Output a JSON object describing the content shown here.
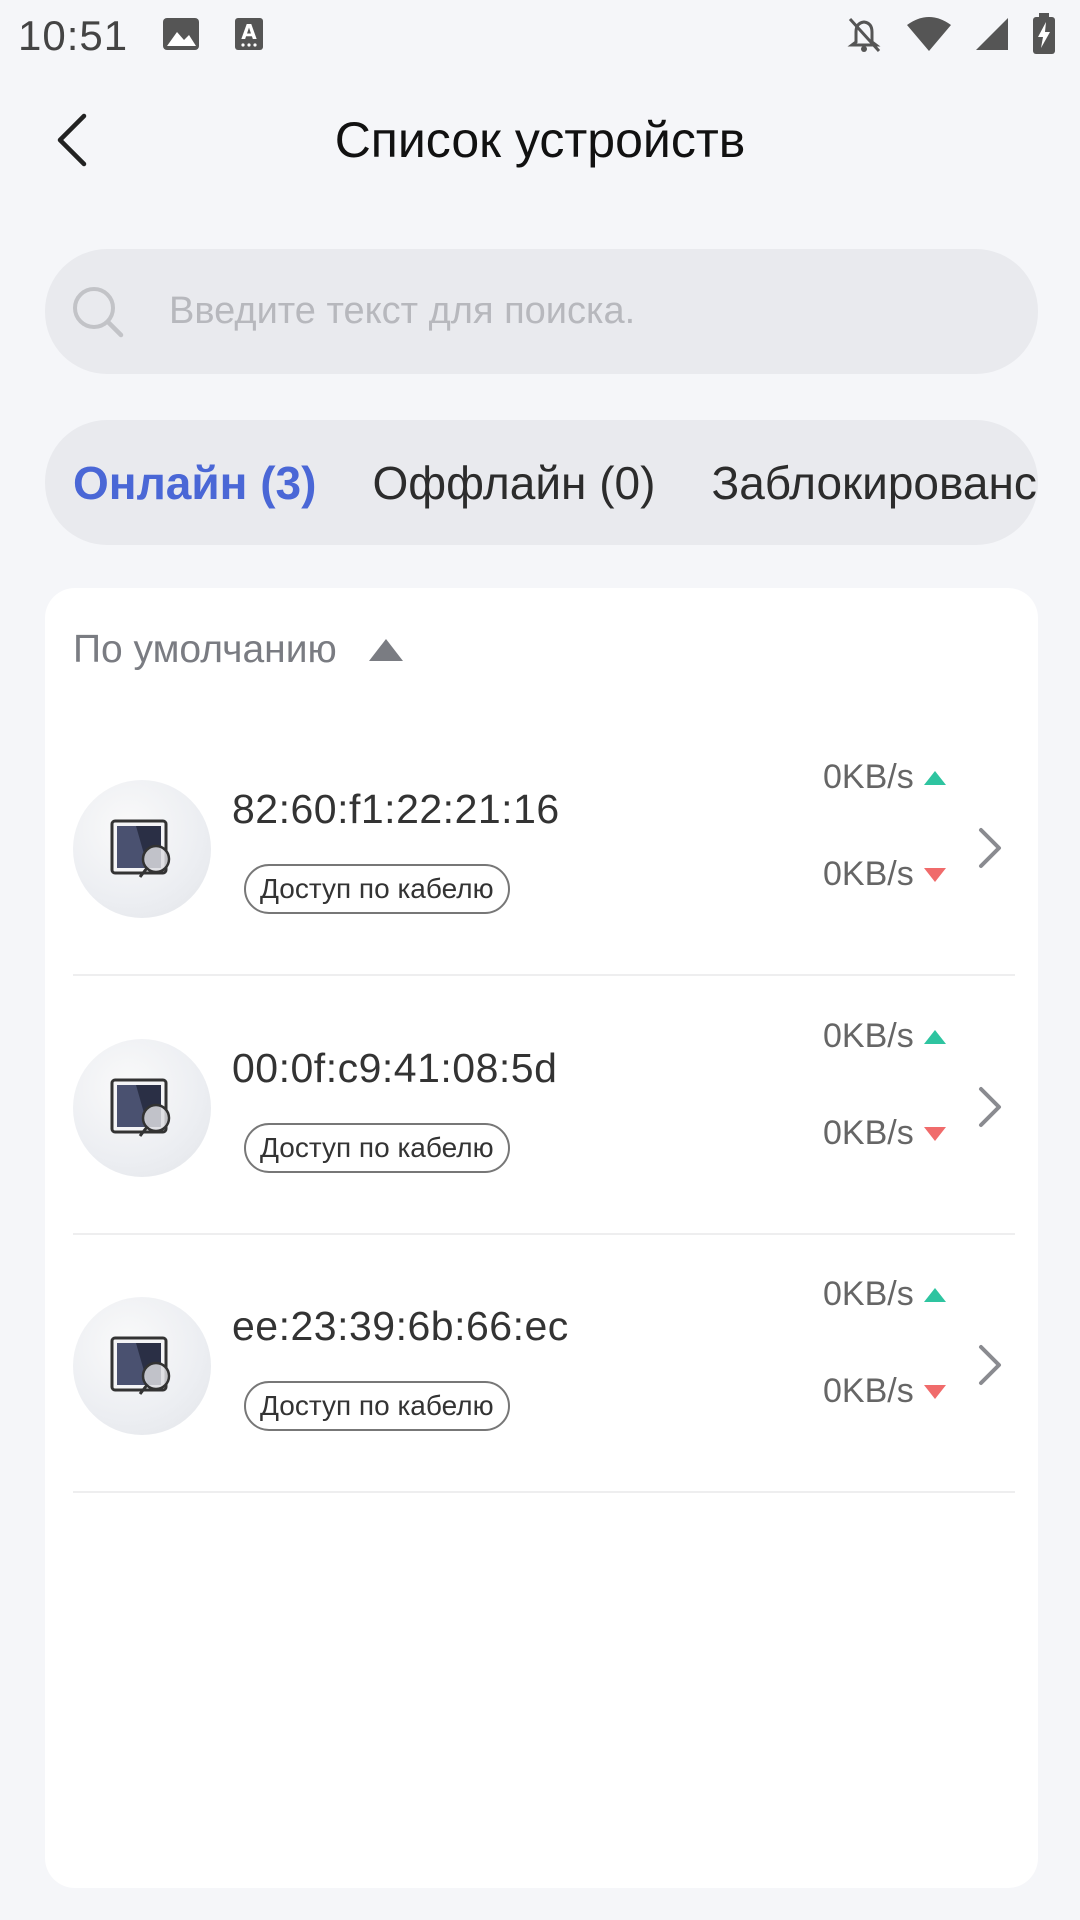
{
  "status_bar": {
    "time": "10:51",
    "left_icons": [
      "image-icon",
      "keyboard-a-icon"
    ],
    "right_icons": [
      "bell-off-icon",
      "wifi-icon",
      "signal-icon",
      "battery-charging-icon"
    ]
  },
  "header": {
    "title": "Список устройств",
    "back_icon": "chevron-left-icon"
  },
  "search": {
    "placeholder": "Введите текст для поиска.",
    "value": "",
    "icon": "search-icon"
  },
  "tabs": [
    {
      "label": "Онлайн (3)",
      "active": true
    },
    {
      "label": "Оффлайн (0)",
      "active": false
    },
    {
      "label": "Заблокированс",
      "active": false
    }
  ],
  "sort": {
    "label": "По умолчанию",
    "icon": "triangle-up-icon"
  },
  "devices": [
    {
      "mac": "82:60:f1:22:21:16",
      "badge": "Доступ по кабелю",
      "upload": "0KB/s",
      "download": "0KB/s"
    },
    {
      "mac": "00:0f:c9:41:08:5d",
      "badge": "Доступ по кабелю",
      "upload": "0KB/s",
      "download": "0KB/s"
    },
    {
      "mac": "ee:23:39:6b:66:ec",
      "badge": "Доступ по кабелю",
      "upload": "0KB/s",
      "download": "0KB/s"
    }
  ],
  "colors": {
    "accent": "#4a67d6",
    "upload_arrow": "#2ec4a0",
    "download_arrow": "#f06b6b",
    "background": "#f5f6f9"
  }
}
